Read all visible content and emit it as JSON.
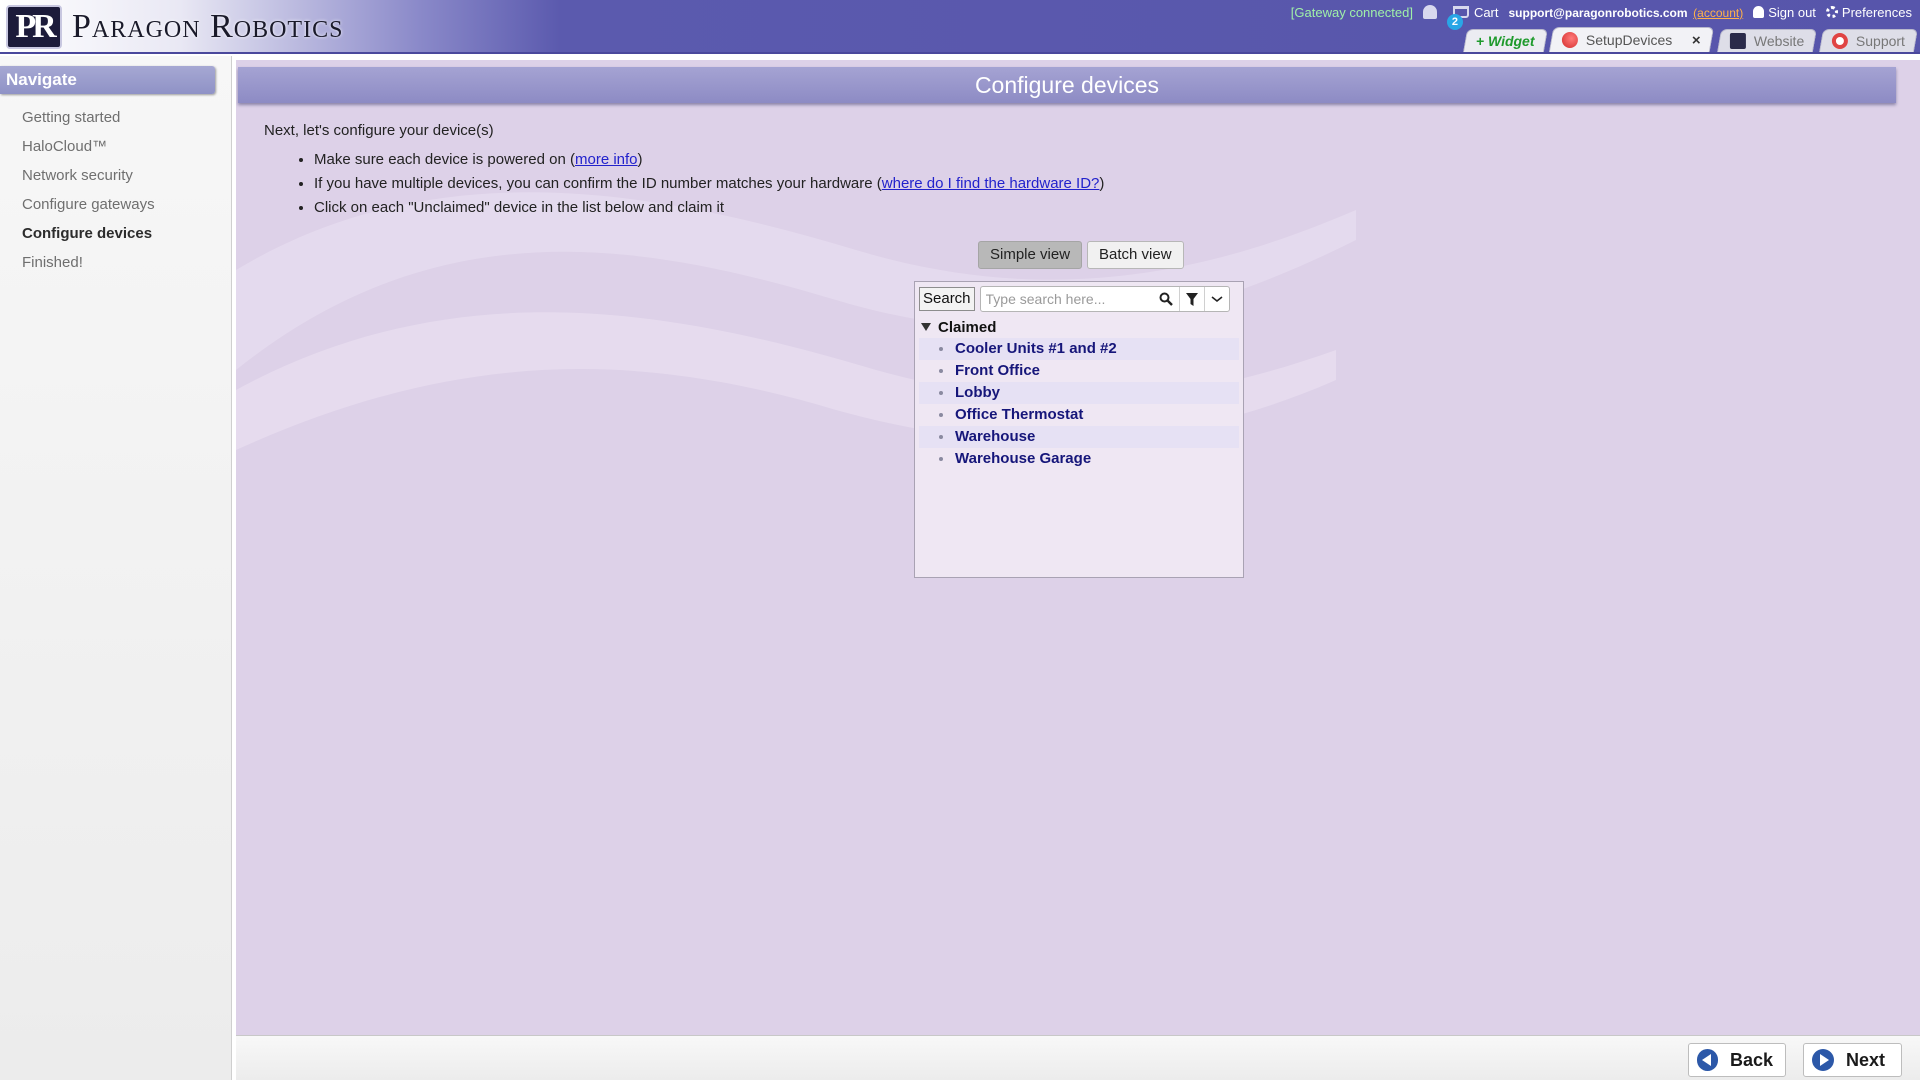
{
  "header": {
    "logo_mark": "PR",
    "brand": "Paragon Robotics",
    "gateway_status": "[Gateway connected]",
    "cart_count": "2",
    "cart_label": "Cart",
    "account_email": "support@paragonrobotics.com",
    "account_link": "(account)",
    "sign_out": "Sign out",
    "preferences": "Preferences",
    "tabs": [
      {
        "label": "+ Widget"
      },
      {
        "label": "SetupDevices",
        "active": true,
        "close": "×"
      },
      {
        "label": "Website"
      },
      {
        "label": "Support"
      }
    ]
  },
  "sidebar": {
    "header": "Navigate",
    "items": [
      {
        "label": "Getting started"
      },
      {
        "label": "HaloCloud™"
      },
      {
        "label": "Network security"
      },
      {
        "label": "Configure gateways"
      },
      {
        "label": "Configure devices",
        "current": true
      },
      {
        "label": "Finished!"
      }
    ]
  },
  "main": {
    "title": "Configure devices",
    "intro": "Next, let's configure your device(s)",
    "instructions": [
      {
        "before": "Make sure each device is powered on (",
        "link": "more info",
        "after": ")"
      },
      {
        "before": "If you have multiple devices, you can confirm the ID number matches your hardware (",
        "link": "where do I find the hardware ID?",
        "after": ")"
      },
      {
        "before": "Click on each \"Unclaimed\" device in the list below and claim it",
        "link": "",
        "after": ""
      }
    ],
    "views": {
      "simple": "Simple view",
      "batch": "Batch view",
      "selected": "simple"
    },
    "search": {
      "label": "Search",
      "placeholder": "Type search here..."
    },
    "group": {
      "name": "Claimed",
      "expanded": true
    },
    "devices": [
      "Cooler Units #1 and #2",
      "Front Office",
      "Lobby",
      "Office Thermostat",
      "Warehouse",
      "Warehouse Garage"
    ]
  },
  "footer": {
    "back": "Back",
    "next": "Next"
  },
  "colors": {
    "header_bg": "#5755ab",
    "main_bg": "#ddd1e8",
    "title_bar": "#9896cc",
    "device_text": "#16167a",
    "gateway_ok": "#9ff0a8",
    "account_link": "#ffb14a"
  }
}
